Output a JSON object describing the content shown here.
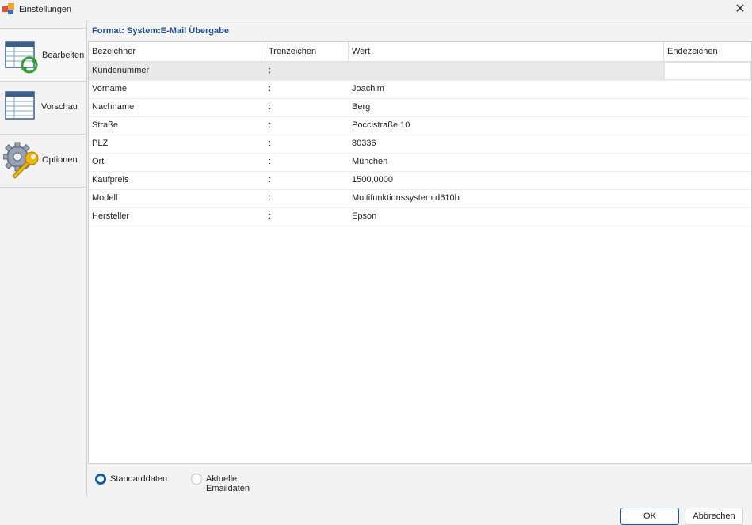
{
  "window": {
    "title": "Einstellungen",
    "close_glyph": "✕"
  },
  "nav": {
    "items": [
      {
        "label": "Bearbeiten",
        "icon": "table-refresh-icon"
      },
      {
        "label": "Vorschau",
        "icon": "table-icon"
      },
      {
        "label": "Optionen",
        "icon": "gear-wrench-icon"
      }
    ]
  },
  "panel": {
    "format_label": "Format:  System:E-Mail Übergabe",
    "columns": [
      "Bezeichner",
      "Trenzeichen",
      "Wert",
      "Endezeichen"
    ],
    "rows": [
      {
        "name": "Kundenummer",
        "sep": ":",
        "value": "",
        "end": ""
      },
      {
        "name": "Vorname",
        "sep": ":",
        "value": "Joachim",
        "end": ""
      },
      {
        "name": "Nachname",
        "sep": ":",
        "value": "Berg",
        "end": ""
      },
      {
        "name": "Straße",
        "sep": ":",
        "value": "Poccistraße 10",
        "end": ""
      },
      {
        "name": "PLZ",
        "sep": ":",
        "value": "80336",
        "end": ""
      },
      {
        "name": "Ort",
        "sep": ":",
        "value": "München",
        "end": ""
      },
      {
        "name": "Kaufpreis",
        "sep": ":",
        "value": "1500,0000",
        "end": ""
      },
      {
        "name": "Modell",
        "sep": ":",
        "value": "Multifunktionssystem d610b",
        "end": ""
      },
      {
        "name": "Hersteller",
        "sep": ":",
        "value": "Epson",
        "end": ""
      }
    ],
    "radio": {
      "standard": {
        "label": "Standarddaten",
        "checked": true
      },
      "current": {
        "label": "Aktuelle Emaildaten",
        "checked": false
      }
    }
  },
  "buttons": {
    "ok": "OK",
    "cancel": "Abbrechen"
  },
  "colors": {
    "accent": "#0f5fa8",
    "format_label": "#1f4e8c",
    "selected_row": "#e9e9e9"
  }
}
